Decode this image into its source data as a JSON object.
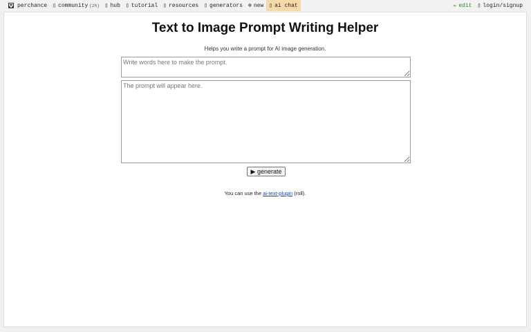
{
  "nav": {
    "left": [
      {
        "icon": "die-icon",
        "label": "perchance"
      },
      {
        "icon": "community-icon",
        "label": "community",
        "extra": "(zh)"
      },
      {
        "icon": "hub-icon",
        "label": "hub"
      },
      {
        "icon": "tutorial-icon",
        "label": "tutorial"
      },
      {
        "icon": "resources-icon",
        "label": "resources"
      },
      {
        "icon": "generators-icon",
        "label": "generators"
      },
      {
        "icon": "plus-circle-icon",
        "label": "new"
      },
      {
        "icon": "chat-icon",
        "label": "ai chat"
      }
    ],
    "right": [
      {
        "icon": "pencil-icon",
        "label": "edit"
      },
      {
        "icon": "user-icon",
        "label": "login/signup"
      }
    ]
  },
  "main": {
    "title": "Text to Image Prompt Writing Helper",
    "subtitle": "Helps you write a prompt for AI image generation.",
    "input_placeholder": "Write words here to make the prompt.",
    "output_placeholder": "The prompt will appear here.",
    "generate_label": "▶ generate",
    "footnote_pre": "You can use the ",
    "footnote_link": "ai-text-plugin",
    "footnote_post": " (roll)."
  },
  "colors": {
    "ai_chat_bg": "#f6d9a8",
    "edit_color": "#2a8a2a",
    "link_color": "#1a3fbf"
  }
}
